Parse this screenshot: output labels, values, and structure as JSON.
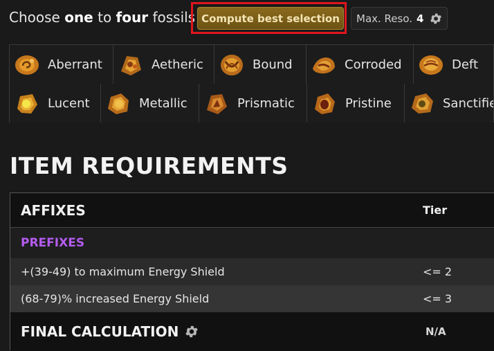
{
  "top_bar": {
    "prefix": "Choose ",
    "one": "one",
    "middle": " to ",
    "four": "four",
    "suffix": " fossils",
    "compute_label": "Compute best selection",
    "maxreso_label": "Max. Reso.",
    "maxreso_value": "4",
    "settings_icon": "gear-icon"
  },
  "fossils": {
    "row1": [
      {
        "label": "Aberrant",
        "icon": "aberrant-fossil-icon"
      },
      {
        "label": "Aetheric",
        "icon": "aetheric-fossil-icon"
      },
      {
        "label": "Bound",
        "icon": "bound-fossil-icon"
      },
      {
        "label": "Corroded",
        "icon": "corroded-fossil-icon"
      },
      {
        "label": "Deft",
        "icon": "deft-fossil-icon"
      }
    ],
    "row2": [
      {
        "label": "Lucent",
        "icon": "lucent-fossil-icon"
      },
      {
        "label": "Metallic",
        "icon": "metallic-fossil-icon"
      },
      {
        "label": "Prismatic",
        "icon": "prismatic-fossil-icon"
      },
      {
        "label": "Pristine",
        "icon": "pristine-fossil-icon"
      },
      {
        "label": "Sanctified",
        "icon": "sanctified-fossil-icon"
      }
    ]
  },
  "requirements": {
    "title": "ITEM REQUIREMENTS",
    "affixes_header": "AFFIXES",
    "tier_header": "Tier",
    "prefixes_label": "PREFIXES",
    "mods": [
      {
        "text": "+(39-49) to maximum Energy Shield",
        "tier": "<= 2"
      },
      {
        "text": "(68-79)% increased Energy Shield",
        "tier": "<= 3"
      }
    ],
    "final_label": "FINAL CALCULATION",
    "final_value": "N/A"
  },
  "colors": {
    "accent_button": "#7b5d17",
    "highlight_border": "#e0161e",
    "prefix_purple": "#b45cf0"
  }
}
